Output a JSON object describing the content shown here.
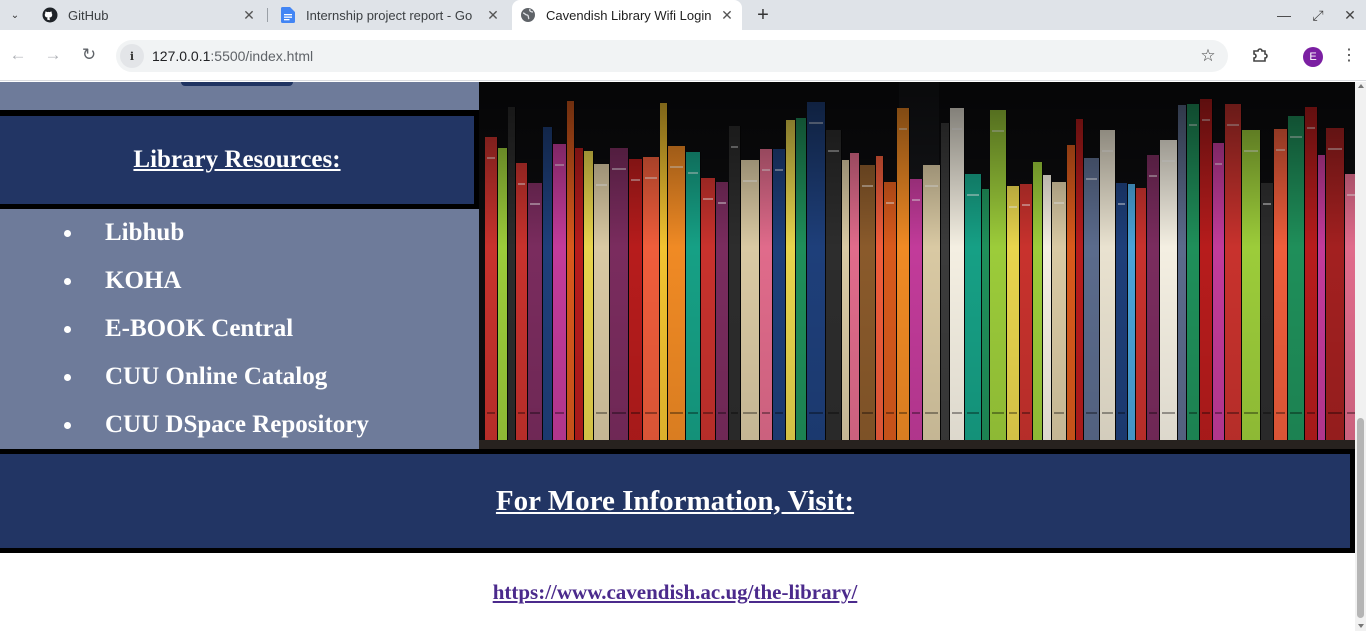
{
  "browser": {
    "tabs": [
      {
        "title": "GitHub",
        "icon": "github-icon"
      },
      {
        "title": "Internship project report - Go",
        "icon": "google-docs-icon"
      },
      {
        "title": "Cavendish Library Wifi Login",
        "icon": "globe-icon",
        "active": true
      }
    ],
    "address": {
      "host": "127.0.0.1",
      "rest": ":5500/index.html"
    },
    "profile_initial": "E"
  },
  "page": {
    "resources_heading": "Library Resources:",
    "resources": [
      "Libhub",
      "KOHA",
      "E-BOOK Central",
      "CUU Online Catalog",
      "CUU DSpace Repository"
    ],
    "info_heading": "For More Information, Visit:",
    "info_link": "https://www.cavendish.ac.ug/the-library/"
  },
  "colors": {
    "navy": "#223564",
    "slate": "#6e7b9a",
    "link": "#4b2a8c"
  }
}
